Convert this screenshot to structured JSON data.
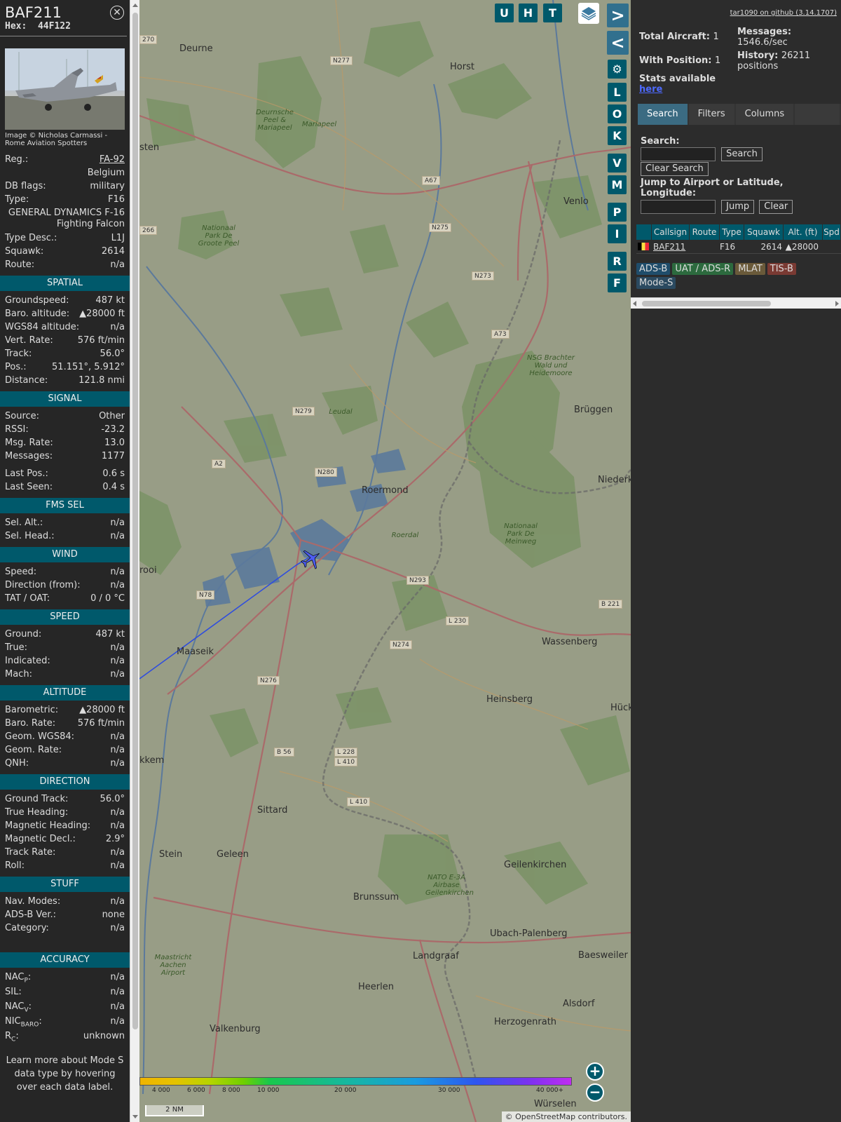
{
  "info": {
    "callsign": "BAF211",
    "hex_label": "Hex:",
    "hex": "44F122",
    "close_icon": "close-icon",
    "photo_credit": "Image © Nicholas Carmassi - Rome Aviation Spotters",
    "reg_label": "Reg.:",
    "reg": "FA-92",
    "country": "Belgium",
    "dbflags_label": "DB flags:",
    "dbflags": "military",
    "type_label": "Type:",
    "type": "F16",
    "type_full": "GENERAL DYNAMICS F-16 Fighting Falcon",
    "typedesc_label": "Type Desc.:",
    "typedesc": "L1J",
    "squawk_label": "Squawk:",
    "squawk": "2614",
    "route_label": "Route:",
    "route": "n/a",
    "sections": {
      "spatial": "SPATIAL",
      "signal": "SIGNAL",
      "fms": "FMS SEL",
      "wind": "WIND",
      "speed": "SPEED",
      "altitude": "ALTITUDE",
      "direction": "DIRECTION",
      "stuff": "STUFF",
      "accuracy": "ACCURACY"
    },
    "spatial": [
      {
        "label": "Groundspeed:",
        "value": "487 kt"
      },
      {
        "label": "Baro. altitude:",
        "value": "▲28000 ft"
      },
      {
        "label": "WGS84 altitude:",
        "value": "n/a"
      },
      {
        "label": "Vert. Rate:",
        "value": "576 ft/min"
      },
      {
        "label": "Track:",
        "value": "56.0°"
      },
      {
        "label": "Pos.:",
        "value": "51.151°, 5.912°"
      },
      {
        "label": "Distance:",
        "value": "121.8 nmi"
      }
    ],
    "signal": [
      {
        "label": "Source:",
        "value": "Other"
      },
      {
        "label": "RSSI:",
        "value": "-23.2"
      },
      {
        "label": "Msg. Rate:",
        "value": "13.0"
      },
      {
        "label": "Messages:",
        "value": "1177"
      }
    ],
    "signal2": [
      {
        "label": "Last Pos.:",
        "value": "0.6 s"
      },
      {
        "label": "Last Seen:",
        "value": "0.4 s"
      }
    ],
    "fms": [
      {
        "label": "Sel. Alt.:",
        "value": "n/a"
      },
      {
        "label": "Sel. Head.:",
        "value": "n/a"
      }
    ],
    "wind": [
      {
        "label": "Speed:",
        "value": "n/a"
      },
      {
        "label": "Direction (from):",
        "value": "n/a"
      },
      {
        "label": "TAT / OAT:",
        "value": "0 / 0 °C"
      }
    ],
    "speed": [
      {
        "label": "Ground:",
        "value": "487 kt"
      },
      {
        "label": "True:",
        "value": "n/a"
      },
      {
        "label": "Indicated:",
        "value": "n/a"
      },
      {
        "label": "Mach:",
        "value": "n/a"
      }
    ],
    "altitude": [
      {
        "label": "Barometric:",
        "value": "▲28000 ft"
      },
      {
        "label": "Baro. Rate:",
        "value": "576 ft/min"
      },
      {
        "label": "Geom. WGS84:",
        "value": "n/a"
      },
      {
        "label": "Geom. Rate:",
        "value": "n/a"
      },
      {
        "label": "QNH:",
        "value": "n/a"
      }
    ],
    "direction": [
      {
        "label": "Ground Track:",
        "value": "56.0°"
      },
      {
        "label": "True Heading:",
        "value": "n/a"
      },
      {
        "label": "Magnetic Heading:",
        "value": "n/a"
      },
      {
        "label": "Magnetic Decl.:",
        "value": "2.9°"
      },
      {
        "label": "Track Rate:",
        "value": "n/a"
      },
      {
        "label": "Roll:",
        "value": "n/a"
      }
    ],
    "stuff": [
      {
        "label": "Nav. Modes:",
        "value": "n/a"
      },
      {
        "label": "ADS-B Ver.:",
        "value": "none"
      },
      {
        "label": "Category:",
        "value": "n/a"
      }
    ],
    "accuracy": [
      {
        "label": "NAC",
        "sub": "P",
        "value": "n/a"
      },
      {
        "label": "SIL:",
        "sub": "",
        "value": "n/a"
      },
      {
        "label": "NAC",
        "sub": "V",
        "value": "n/a"
      },
      {
        "label": "NIC",
        "sub": "BARO",
        "value": "n/a"
      },
      {
        "label": "R",
        "sub": "C",
        "value": "unknown"
      }
    ],
    "footnote": "Learn more about Mode S data type by hovering over each data label."
  },
  "map": {
    "top_buttons": [
      "U",
      "H",
      "T"
    ],
    "side_buttons": [
      "L",
      "O",
      "K",
      "V",
      "M",
      "P",
      "I",
      "R",
      "F"
    ],
    "places": [
      "Deurne",
      "Horst",
      "Venlo",
      "Roermond",
      "Brüggen",
      "Niederkr",
      "Wassenberg",
      "Heinsberg",
      "Hück",
      "Maaseik",
      "Sittard",
      "Geleen",
      "Stein",
      "Brunssum",
      "Geilenkirchen",
      "Ubach-Palenberg",
      "Baesweiler",
      "Landgraaf",
      "Heerlen",
      "Alsdorf",
      "Herzogenrath",
      "Valkenburg",
      "Würselen",
      "kkem",
      "rooi",
      "sten"
    ],
    "nature": [
      "Deurnsche Peel & Mariapeel",
      "Mariapeel",
      "Nationaal Park De Groote Peel",
      "NSG Brachter Wald und Heidemoore",
      "Nationaal Park De Meinweg",
      "Leudal",
      "Roerdal",
      "NATO E-3A Airbase Geilenkirchen",
      "Maastricht Aachen Airport"
    ],
    "roads": [
      "N277",
      "A67",
      "N275",
      "N273",
      "A73",
      "N279",
      "A2",
      "N280",
      "N293",
      "N78",
      "L 230",
      "N274",
      "B 221",
      "N276",
      "B 56",
      "L 228",
      "L 410",
      "L 410",
      "266",
      "270"
    ],
    "altitude_ticks": [
      "4 000",
      "6 000",
      "8 000",
      "10 000",
      "20 000",
      "30 000",
      "40 000+"
    ],
    "scale": "2 NM",
    "attribution_prefix": "© ",
    "attribution_link": "OpenStreetMap",
    "attribution_suffix": " contributors."
  },
  "sidebar": {
    "github": "tar1090 on github (3.14.1707)",
    "total_label": "Total Aircraft:",
    "total": "1",
    "withpos_label": "With Position:",
    "withpos": "1",
    "stats_label": "Stats available",
    "stats_link": "here",
    "messages_label": "Messages:",
    "messages": "1546.6/sec",
    "history_label": "History:",
    "history": "26211 positions",
    "tabs": [
      "Search",
      "Filters",
      "Columns"
    ],
    "search_label": "Search:",
    "search_button": "Search",
    "clear_search_button": "Clear Search",
    "jump_label": "Jump to Airport or Latitude, Longitude:",
    "jump_button": "Jump",
    "clear_button": "Clear",
    "columns": [
      "",
      "Callsign",
      "Route",
      "Type",
      "Squawk",
      "Alt. (ft)",
      "Spd"
    ],
    "rows": [
      {
        "callsign": "BAF211",
        "route": "",
        "type": "F16",
        "squawk": "2614",
        "alt": "▲28000",
        "spd": ""
      }
    ],
    "legend": [
      {
        "label": "ADS-B",
        "color": "#1f4d6b"
      },
      {
        "label": "UAT / ADS-R",
        "color": "#2c6a3e"
      },
      {
        "label": "MLAT",
        "color": "#6a5a3a"
      },
      {
        "label": "TIS-B",
        "color": "#7a3a33"
      },
      {
        "label": "Mode-S",
        "color": "#2b4a60"
      }
    ]
  }
}
